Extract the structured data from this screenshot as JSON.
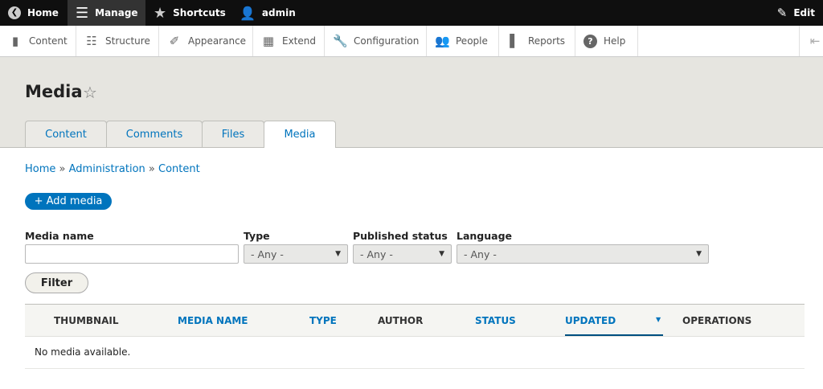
{
  "toolbar": {
    "home": "Home",
    "manage": "Manage",
    "shortcuts": "Shortcuts",
    "user": "admin",
    "edit": "Edit"
  },
  "tray": {
    "items": [
      "Content",
      "Structure",
      "Appearance",
      "Extend",
      "Configuration",
      "People",
      "Reports",
      "Help"
    ]
  },
  "page": {
    "title": "Media"
  },
  "tabs": [
    "Content",
    "Comments",
    "Files",
    "Media"
  ],
  "breadcrumb": [
    "Home",
    "Administration",
    "Content"
  ],
  "breadcrumb_sep": "»",
  "add_button": "+ Add media",
  "filters": {
    "media_name": {
      "label": "Media name",
      "value": ""
    },
    "type": {
      "label": "Type",
      "value": "- Any -"
    },
    "published": {
      "label": "Published status",
      "value": "- Any -"
    },
    "language": {
      "label": "Language",
      "value": "- Any -"
    },
    "submit": "Filter"
  },
  "table": {
    "headers": [
      "THUMBNAIL",
      "MEDIA NAME",
      "TYPE",
      "AUTHOR",
      "STATUS",
      "UPDATED",
      "OPERATIONS"
    ],
    "empty": "No media available."
  },
  "colors": {
    "link": "#0074bd",
    "toolbar": "#0f0f0f"
  }
}
